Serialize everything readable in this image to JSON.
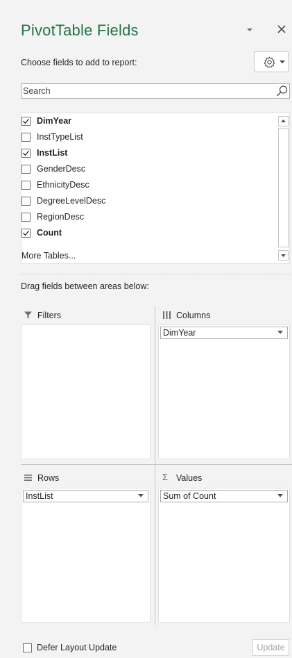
{
  "header": {
    "title": "PivotTable Fields",
    "choose_label": "Choose fields to add to report:",
    "accent_color": "#217346"
  },
  "search": {
    "placeholder": "Search"
  },
  "fields": [
    {
      "label": "DimYear",
      "checked": true
    },
    {
      "label": "InstTypeList",
      "checked": false
    },
    {
      "label": "InstList",
      "checked": true
    },
    {
      "label": "GenderDesc",
      "checked": false
    },
    {
      "label": "EthnicityDesc",
      "checked": false
    },
    {
      "label": "DegreeLevelDesc",
      "checked": false
    },
    {
      "label": "RegionDesc",
      "checked": false
    },
    {
      "label": "Count",
      "checked": true
    }
  ],
  "more_tables": "More Tables...",
  "areas": {
    "drag_label": "Drag fields between areas below:",
    "filters": {
      "label": "Filters",
      "icon": "filter-icon"
    },
    "columns": {
      "label": "Columns",
      "icon": "columns-icon",
      "item": "DimYear"
    },
    "rows": {
      "label": "Rows",
      "icon": "rows-icon",
      "item": "InstList"
    },
    "values": {
      "label": "Values",
      "icon": "sigma-icon",
      "item": "Sum of Count"
    }
  },
  "footer": {
    "defer_label": "Defer Layout Update",
    "defer_checked": false,
    "update_label": "Update"
  }
}
